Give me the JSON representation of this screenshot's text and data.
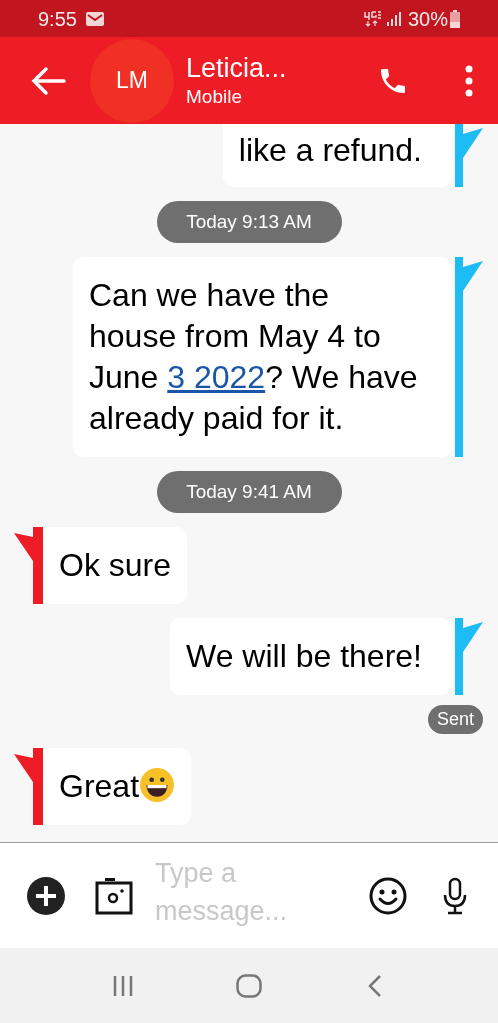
{
  "status_bar": {
    "time": "9:55",
    "battery": "30%"
  },
  "header": {
    "avatar": "LM",
    "name": "Leticia...",
    "subtitle": "Mobile"
  },
  "messages": [
    {
      "kind": "message",
      "outgoing": true,
      "parts": [
        {
          "text": "like a refund.",
          "link": false
        }
      ]
    },
    {
      "kind": "timestamp",
      "text": "Today 9:13 AM"
    },
    {
      "kind": "message",
      "outgoing": true,
      "parts": [
        {
          "text": "Can we have the house from May 4 to June ",
          "link": false
        },
        {
          "text": "3 2022",
          "link": true
        },
        {
          "text": "? We have already paid for it.",
          "link": false
        }
      ]
    },
    {
      "kind": "timestamp",
      "text": "Today 9:41 AM"
    },
    {
      "kind": "message",
      "outgoing": false,
      "parts": [
        {
          "text": "Ok sure",
          "link": false
        }
      ]
    },
    {
      "kind": "message",
      "outgoing": true,
      "parts": [
        {
          "text": "We will be there!",
          "link": false
        }
      ]
    },
    {
      "kind": "status",
      "text": "Sent"
    },
    {
      "kind": "message",
      "outgoing": false,
      "parts": [
        {
          "text": "Great",
          "link": false
        }
      ],
      "emoji": true
    }
  ],
  "composer": {
    "placeholder": "Type a message..."
  }
}
